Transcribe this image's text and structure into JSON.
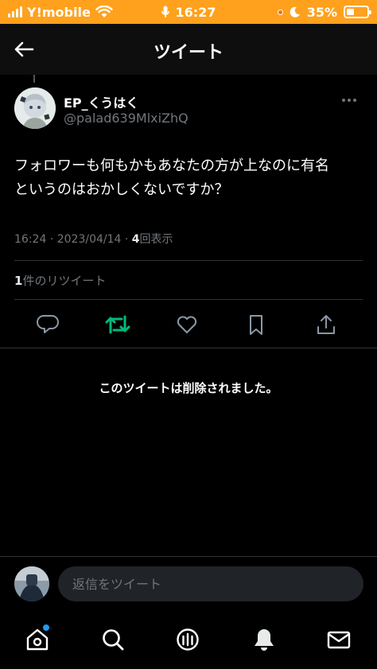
{
  "status_bar": {
    "carrier": "Y!mobile",
    "time": "16:27",
    "battery": "35%"
  },
  "header": {
    "title": "ツイート"
  },
  "tweet": {
    "author": {
      "display_name": "EP_くうはく",
      "handle": "@palad639MlxiZhQ"
    },
    "text": "フォロワーも何もかもあなたの方が上なのに有名\nというのはおかしくないですか？",
    "time": "16:24",
    "date": "2023/04/14",
    "separator": "·",
    "views_count": "4",
    "views_label": "回表示",
    "retweets_count": "1",
    "retweets_label": "件のリツイート"
  },
  "actions": [
    "reply",
    "retweet",
    "like",
    "bookmark",
    "share"
  ],
  "colors": {
    "status_bar_bg": "#ffa11c",
    "retweet_active": "#00ba7c",
    "notification_dot": "#1d9bf0"
  },
  "deleted_notice": "このツイートは削除されました。",
  "reply_bar": {
    "placeholder": "返信をツイート"
  },
  "tabs": [
    "home",
    "search",
    "spaces",
    "notifications",
    "messages"
  ]
}
